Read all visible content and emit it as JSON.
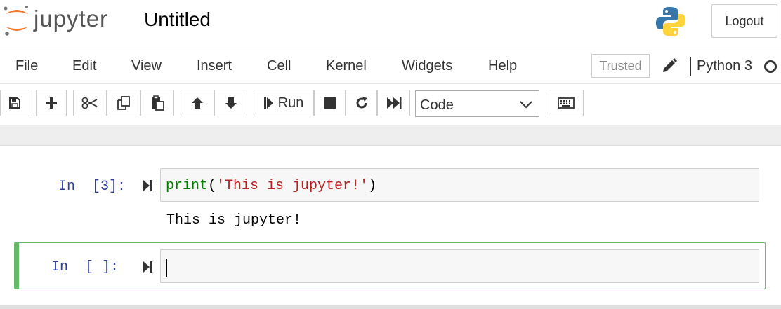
{
  "header": {
    "logo_text": "jupyter",
    "notebook_title": "Untitled",
    "logout_label": "Logout",
    "python_logo_icon": "python-logo-icon"
  },
  "menubar": {
    "items": [
      "File",
      "Edit",
      "View",
      "Insert",
      "Cell",
      "Kernel",
      "Widgets",
      "Help"
    ],
    "trusted_label": "Trusted",
    "kernel_name": "Python 3",
    "edit_icon": "pencil-icon",
    "kernel_status_icon": "kernel-idle-circle-icon"
  },
  "toolbar": {
    "buttons": [
      {
        "name": "save",
        "icon": "floppy-disk-icon"
      },
      {
        "name": "insert-cell-below",
        "icon": "plus-icon"
      },
      {
        "name": "cut",
        "icon": "scissors-icon"
      },
      {
        "name": "copy",
        "icon": "copy-icon"
      },
      {
        "name": "paste",
        "icon": "paste-icon"
      },
      {
        "name": "move-up",
        "icon": "arrow-up-icon"
      },
      {
        "name": "move-down",
        "icon": "arrow-down-icon"
      },
      {
        "name": "run",
        "icon": "step-forward-icon"
      },
      {
        "name": "interrupt",
        "icon": "stop-icon"
      },
      {
        "name": "restart",
        "icon": "restart-icon"
      },
      {
        "name": "restart-run-all",
        "icon": "fast-forward-icon"
      },
      {
        "name": "command-palette",
        "icon": "keyboard-icon"
      }
    ],
    "run_label": "Run",
    "cell_type": "Code"
  },
  "cells": [
    {
      "prompt": "In  [3]:",
      "code_func": "print",
      "code_open": "(",
      "code_string": "'This is jupyter!'",
      "code_close": ")",
      "output": "This is jupyter!"
    },
    {
      "prompt": "In  [ ]:",
      "code": ""
    }
  ],
  "colors": {
    "prompt": "#303f9f",
    "keyword": "#008000",
    "string": "#ba2121",
    "selected_cell_border": "#66bb6a",
    "jupyter_orange": "#f37726"
  }
}
